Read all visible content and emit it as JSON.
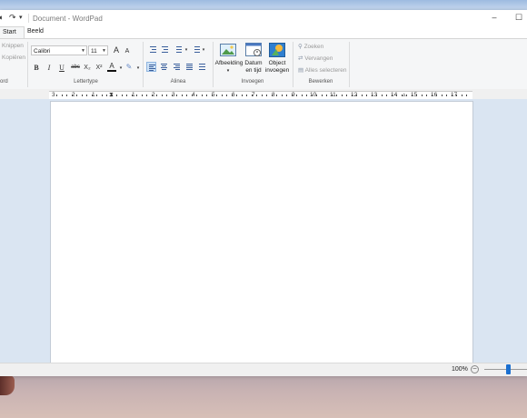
{
  "window": {
    "title": "Document - WordPad",
    "minimize": "–",
    "maximize": "☐"
  },
  "tabs": [
    {
      "label": "Start",
      "active": true
    },
    {
      "label": "Beeld",
      "active": false
    }
  ],
  "clipboard": {
    "cut": "Knippen",
    "copy": "Kopiëren",
    "group": "ord"
  },
  "font": {
    "family": "Calibri",
    "size": "11",
    "grow": "A",
    "shrink": "A",
    "bold": "B",
    "italic": "I",
    "underline": "U",
    "strike": "abc",
    "subscript": "X₂",
    "superscript": "X²",
    "color": "A",
    "group": "Lettertype"
  },
  "paragraph": {
    "group": "Alinea"
  },
  "insert": {
    "picture": "Afbeelding",
    "datetime_1": "Datum",
    "datetime_2": "en tijd",
    "object_1": "Object",
    "object_2": "invoegen",
    "group": "Invoegen"
  },
  "edit": {
    "find": "Zoeken",
    "replace": "Vervangen",
    "select_all": "Alles selecteren",
    "group": "Bewerken"
  },
  "ruler": {
    "labels": [
      "3",
      "2",
      "1",
      "1",
      "2",
      "3",
      "4",
      "5",
      "6",
      "7",
      "8",
      "9",
      "10",
      "11",
      "12",
      "13",
      "14",
      "15",
      "16",
      "17"
    ]
  },
  "status": {
    "zoom": "100%",
    "zoom_out": "−"
  },
  "colors": {
    "accent": "#1a6fd0",
    "ribbon_bg": "#f5f6f7",
    "doc_bg": "#dae5f2"
  }
}
